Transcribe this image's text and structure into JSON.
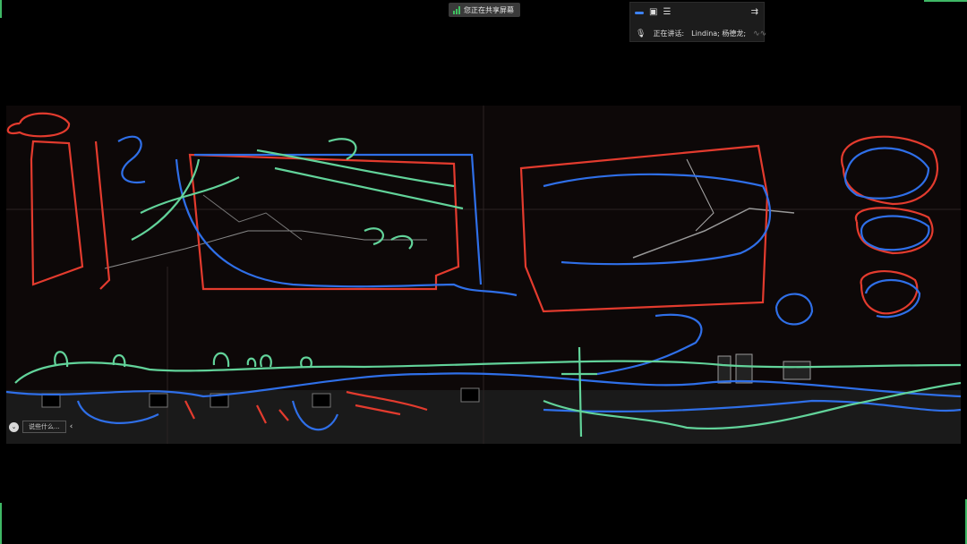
{
  "share_badge": {
    "text": "您正在共享屏幕",
    "icon": "signal-bars-icon",
    "color": "#3fc060"
  },
  "meeting_panel": {
    "speaking_label": "正在讲话:",
    "speakers": "Lindina; 杨德龙;",
    "icons": [
      "view-pill-icon",
      "window-icon",
      "stack-icon",
      "menu-icon",
      "mic-icon",
      "waveform-icon"
    ],
    "accent": "#3d82f5"
  },
  "canvas": {
    "hint_text": "说些什么...",
    "ink_colors": {
      "red": "#e33b2e",
      "blue": "#2f6fe8",
      "green": "#62d39a"
    }
  }
}
